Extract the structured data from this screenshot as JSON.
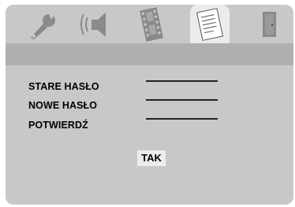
{
  "tabs": [
    {
      "icon": "wrench-icon",
      "active": false
    },
    {
      "icon": "speaker-icon",
      "active": false
    },
    {
      "icon": "film-icon",
      "active": false
    },
    {
      "icon": "document-icon",
      "active": true
    },
    {
      "icon": "exit-door-icon",
      "active": false
    }
  ],
  "form": {
    "old_password_label": "STARE HASŁO",
    "new_password_label": "NOWE HASŁO",
    "confirm_label": "POTWIERDŹ",
    "old_password_value": "",
    "new_password_value": "",
    "confirm_value": ""
  },
  "ok_button": {
    "label": "TAK"
  },
  "colors": {
    "panel": "#c8c8c8",
    "band": "#b0b0b0",
    "active_tab": "#ececec",
    "icon": "#8a8a8a"
  }
}
